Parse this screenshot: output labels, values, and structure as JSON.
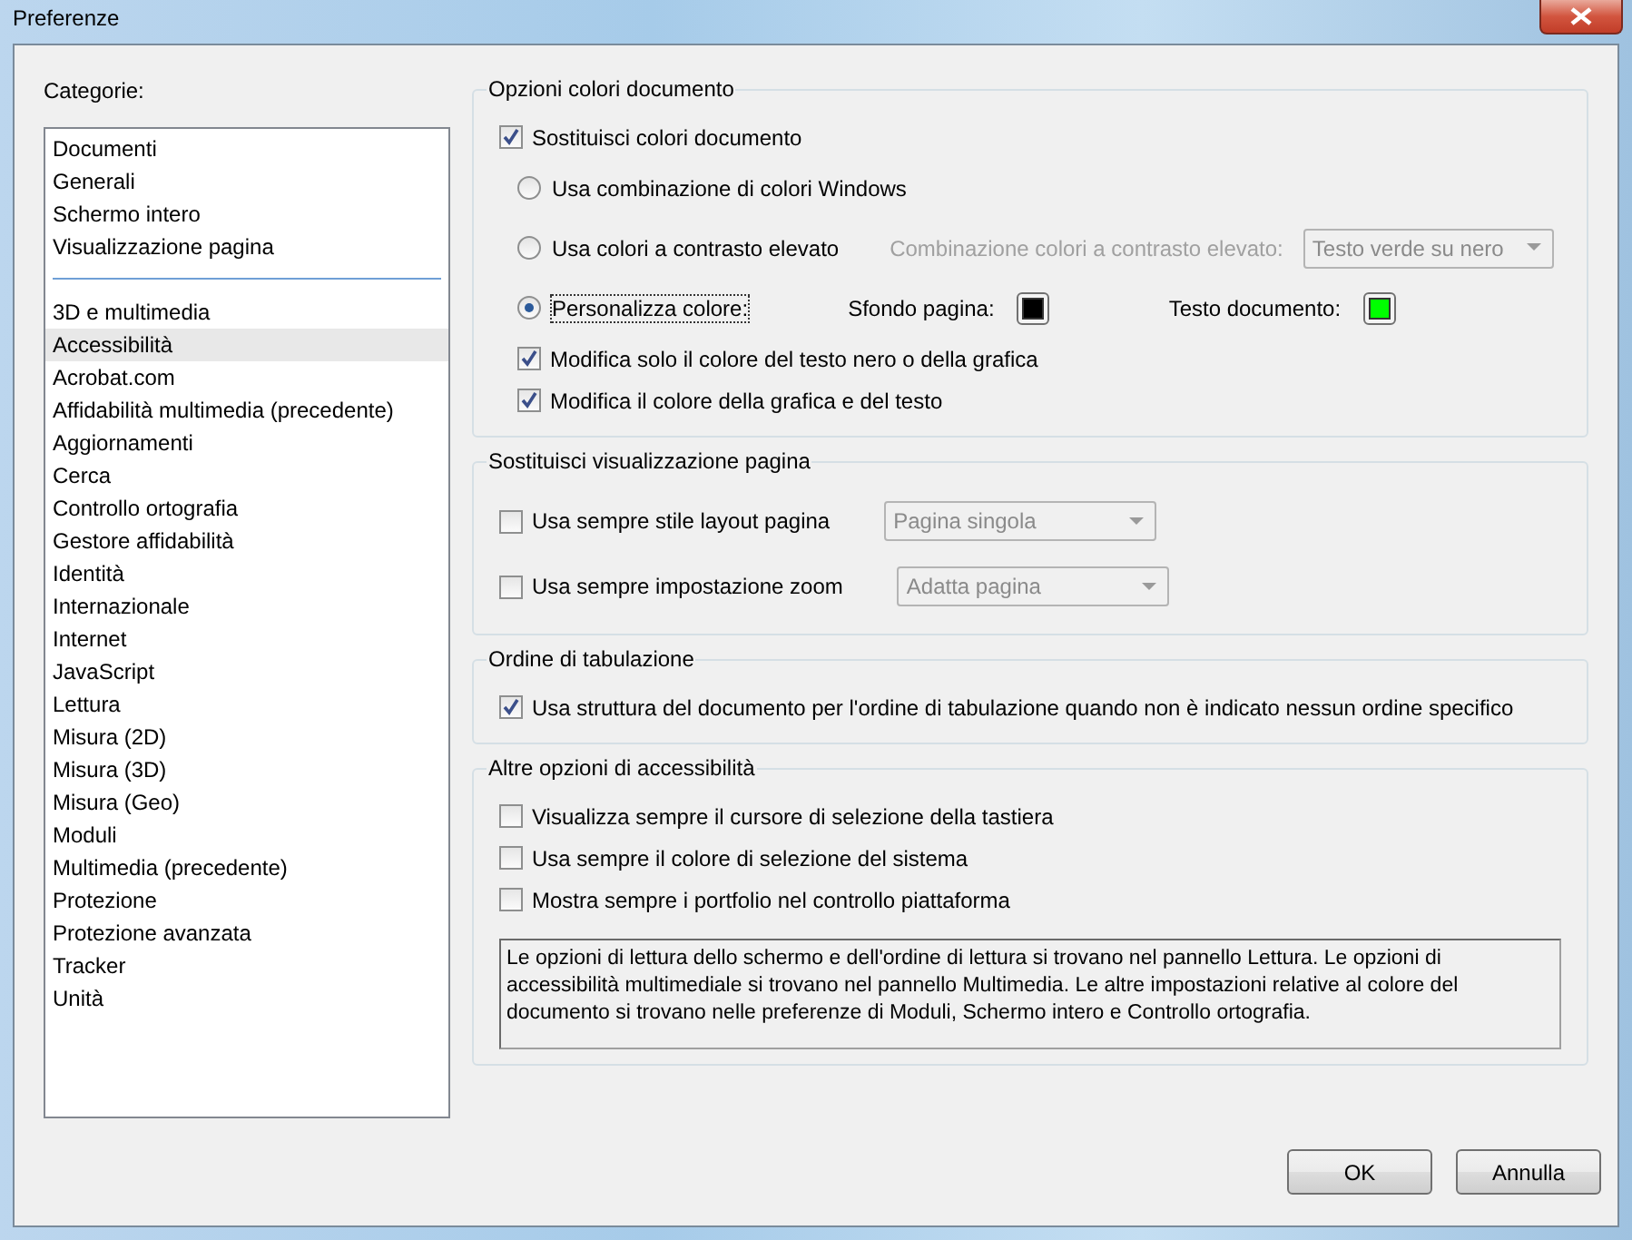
{
  "window": {
    "title": "Preferenze"
  },
  "categories": {
    "label": "Categorie:",
    "groups": [
      [
        {
          "label": "Documenti",
          "selected": false
        },
        {
          "label": "Generali",
          "selected": false
        },
        {
          "label": "Schermo intero",
          "selected": false
        },
        {
          "label": "Visualizzazione pagina",
          "selected": false
        }
      ],
      [
        {
          "label": "3D e multimedia",
          "selected": false
        },
        {
          "label": "Accessibilità",
          "selected": true
        },
        {
          "label": "Acrobat.com",
          "selected": false
        },
        {
          "label": "Affidabilità multimedia (precedente)",
          "selected": false
        },
        {
          "label": "Aggiornamenti",
          "selected": false
        },
        {
          "label": "Cerca",
          "selected": false
        },
        {
          "label": "Controllo ortografia",
          "selected": false
        },
        {
          "label": "Gestore affidabilità",
          "selected": false
        },
        {
          "label": "Identità",
          "selected": false
        },
        {
          "label": "Internazionale",
          "selected": false
        },
        {
          "label": "Internet",
          "selected": false
        },
        {
          "label": "JavaScript",
          "selected": false
        },
        {
          "label": "Lettura",
          "selected": false
        },
        {
          "label": "Misura (2D)",
          "selected": false
        },
        {
          "label": "Misura (3D)",
          "selected": false
        },
        {
          "label": "Misura (Geo)",
          "selected": false
        },
        {
          "label": "Moduli",
          "selected": false
        },
        {
          "label": "Multimedia (precedente)",
          "selected": false
        },
        {
          "label": "Protezione",
          "selected": false
        },
        {
          "label": "Protezione avanzata",
          "selected": false
        },
        {
          "label": "Tracker",
          "selected": false
        },
        {
          "label": "Unità",
          "selected": false
        }
      ]
    ]
  },
  "sections": [
    {
      "title": "Opzioni colori documento",
      "rows": [
        {
          "kind": "checkbox",
          "label": "Sostituisci colori documento",
          "checked": true,
          "children": [
            {
              "kind": "radio",
              "label": "Usa combinazione di colori Windows",
              "selected": false
            },
            {
              "kind": "radio",
              "label": "Usa colori a contrasto elevato",
              "selected": false,
              "combo": {
                "label": "Combinazione colori a contrasto elevato:",
                "value": "Testo verde su nero",
                "disabled": true
              }
            },
            {
              "kind": "radio",
              "label": "Personalizza colore:",
              "selected": true,
              "swatches": [
                {
                  "label": "Sfondo pagina:",
                  "color": "#000000"
                },
                {
                  "label": "Testo documento:",
                  "color": "#00ff00"
                }
              ]
            },
            {
              "kind": "checkbox",
              "label": "Modifica solo il colore del testo nero o della grafica",
              "checked": true
            },
            {
              "kind": "checkbox",
              "label": "Modifica il colore della grafica e del testo",
              "checked": true
            }
          ]
        }
      ]
    },
    {
      "title": "Sostituisci visualizzazione pagina",
      "rows": [
        {
          "kind": "checkbox",
          "label": "Usa sempre stile layout pagina",
          "checked": false,
          "dropdown": {
            "value": "Pagina singola",
            "disabled": true
          }
        },
        {
          "kind": "checkbox",
          "label": "Usa sempre impostazione zoom",
          "checked": false,
          "dropdown": {
            "value": "Adatta pagina",
            "disabled": true
          }
        }
      ]
    },
    {
      "title": "Ordine di tabulazione",
      "rows": [
        {
          "kind": "checkbox",
          "label": "Usa struttura del documento per l'ordine di tabulazione quando non è indicato nessun ordine specifico",
          "checked": true
        }
      ]
    },
    {
      "title": "Altre opzioni di accessibilità",
      "rows": [
        {
          "kind": "checkbox",
          "label": "Visualizza sempre il cursore di selezione della tastiera",
          "checked": false
        },
        {
          "kind": "checkbox",
          "label": "Usa sempre il colore di selezione del sistema",
          "checked": false
        },
        {
          "kind": "checkbox",
          "label": "Mostra sempre i portfolio nel controllo piattaforma",
          "checked": false
        },
        {
          "kind": "note",
          "text": "Le opzioni di lettura dello schermo e dell'ordine di lettura si trovano nel pannello Lettura. Le opzioni di accessibilità multimediale si trovano nel pannello Multimedia. Le altre impostazioni relative al colore del documento si trovano nelle preferenze di Moduli, Schermo intero e Controllo ortografia."
        }
      ]
    }
  ],
  "buttons": [
    "OK",
    "Annulla"
  ]
}
